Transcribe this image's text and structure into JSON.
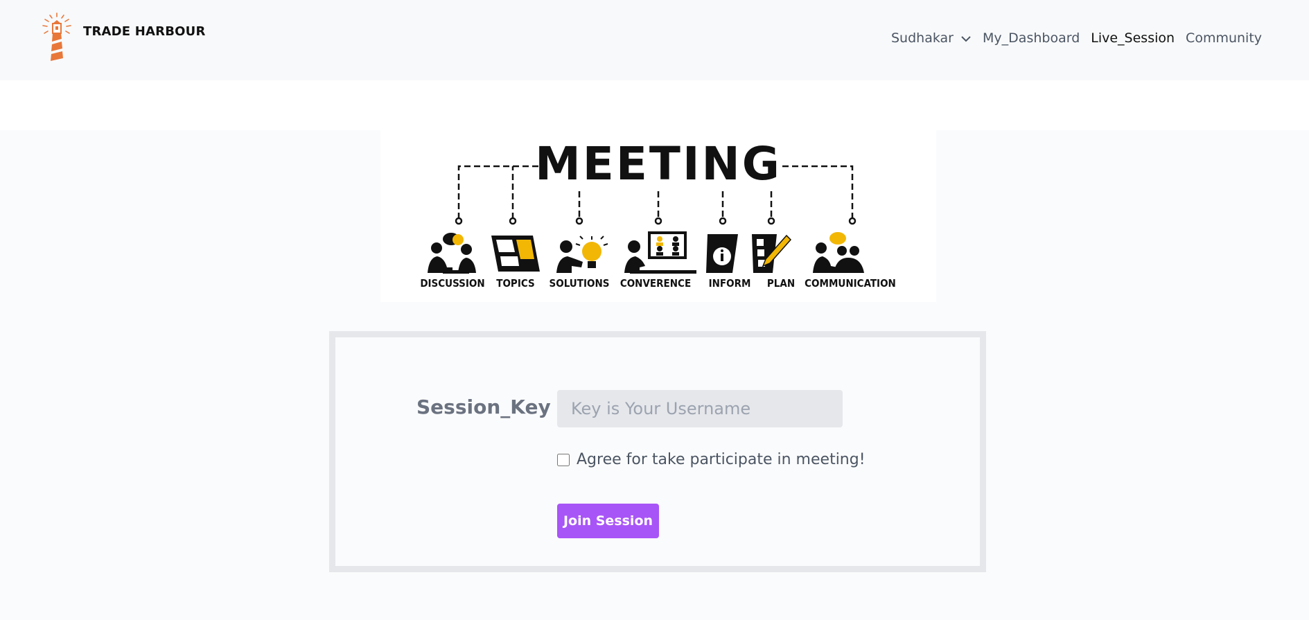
{
  "brand": {
    "name": "TRADE HARBOUR",
    "accent": "#e8773a"
  },
  "nav": {
    "user_label": "Sudhakar",
    "items": [
      {
        "label": "My_Dashboard"
      },
      {
        "label": "Live_Session"
      },
      {
        "label": "Community"
      }
    ]
  },
  "banner": {
    "title": "MEETING",
    "labels": [
      "DISCUSSION",
      "TOPICS",
      "SOLUTIONS",
      "CONVERENCE",
      "INFORM",
      "PLAN",
      "COMMUNICATION"
    ],
    "accent": "#f2b705"
  },
  "form": {
    "key_label": "Session_Key :",
    "key_placeholder": "Key is Your Username",
    "key_value": "",
    "agree_label": "Agree for take participate in meeting!",
    "agree_checked": false,
    "join_label": "Join Session",
    "button_color": "#a855f7"
  }
}
